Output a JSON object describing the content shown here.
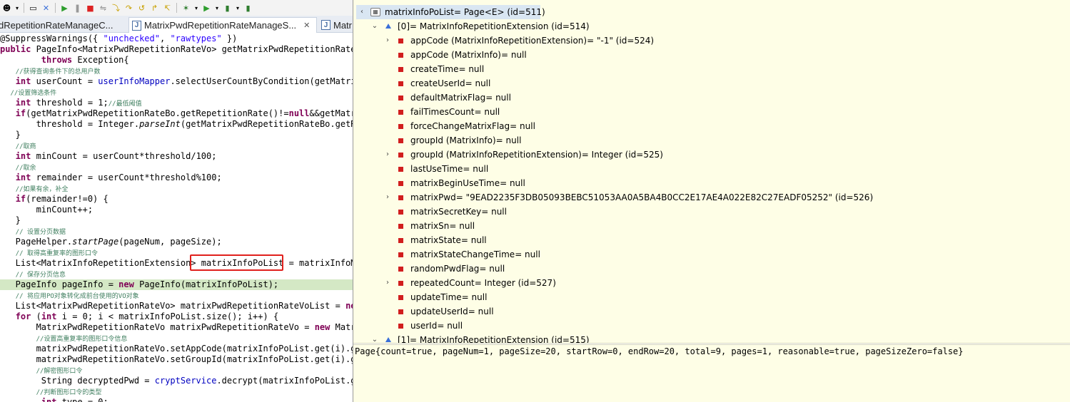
{
  "toolbar": {
    "icons": [
      "person-icon",
      "dropdown-icon",
      "console-icon",
      "pin-icon",
      "resume-icon",
      "suspend-icon",
      "terminate-icon",
      "disconnect-icon",
      "step-into-icon",
      "step-over-icon",
      "step-return-icon",
      "drop-to-frame-icon",
      "use-step-filters-icon",
      "debug-icon",
      "run-icon",
      "external-tools-icon",
      "coverage-icon"
    ]
  },
  "tabs": [
    {
      "label": "dRepetitionRateManageC...",
      "active": false
    },
    {
      "label": "MatrixPwdRepetitionRateManageS...",
      "active": true,
      "close": "✕"
    },
    {
      "label": "Matr",
      "active": false
    }
  ],
  "code_lines": [
    "@SuppressWarnings({ \"unchecked\", \"rawtypes\" })",
    "public PageInfo<MatrixPwdRepetitionRateVo> getMatrixPwdRepetitionRateLi",
    "        throws Exception{",
    "   //获得查询条件下的总用户数",
    "   int userCount = userInfoMapper.selectUserCountByCondition(getMatrix",
    "  //设置筛选条件",
    "   int threshold = 1;//最低阈值",
    "   if(getMatrixPwdRepetitionRateBo.getRepetitionRate()!=null&&getMatri",
    "       threshold = Integer.parseInt(getMatrixPwdRepetitionRateBo.getRe",
    "   }",
    "   //取商",
    "   int minCount = userCount*threshold/100;",
    "   //取余",
    "   int remainder = userCount*threshold%100;",
    "   //如果有余，补全",
    "   if(remainder!=0) {",
    "       minCount++;",
    "   }",
    "   // 设置分页数据",
    "   PageHelper.startPage(pageNum, pageSize);",
    "   // 取得高重复率的图形口令",
    "   List<MatrixInfoRepetitionExtension> matrixInfoPoList = matrixInfoMa",
    "   // 保存分页信息",
    "   PageInfo pageInfo = new PageInfo(matrixInfoPoList);",
    "   // 将应用PO对象转化成前台使用的VO对象",
    "   List<MatrixPwdRepetitionRateVo> matrixPwdRepetitionRateVoList = new",
    "   for (int i = 0; i < matrixInfoPoList.size(); i++) {",
    "       MatrixPwdRepetitionRateVo matrixPwdRepetitionRateVo = new Matri",
    "       //设置高重复率的图形口令信息",
    "       matrixPwdRepetitionRateVo.setAppCode(matrixInfoPoList.get(i).ge",
    "       matrixPwdRepetitionRateVo.setGroupId(matrixInfoPoList.get(i).ge",
    "       //解密图形口令",
    "        String decryptedPwd = cryptService.decrypt(matrixInfoPoList.ge",
    "       //判断图形口令的类型",
    "        int type = 0;"
  ],
  "debug": {
    "root": "matrixInfoPoList= Page<E>  (id=511)",
    "items": [
      {
        "label": "[0]= MatrixInfoRepetitionExtension  (id=514)",
        "twisty": "⌄",
        "icon": "final-field-icon",
        "level": 1
      },
      {
        "label": "appCode (MatrixInfoRepetitionExtension)= \"-1\" (id=524)",
        "twisty": "›",
        "icon": "field-icon",
        "level": 2
      },
      {
        "label": "appCode (MatrixInfo)= null",
        "twisty": "",
        "icon": "field-icon",
        "level": 2
      },
      {
        "label": "createTime= null",
        "twisty": "",
        "icon": "field-icon",
        "level": 2
      },
      {
        "label": "createUserId= null",
        "twisty": "",
        "icon": "field-icon",
        "level": 2
      },
      {
        "label": "defaultMatrixFlag= null",
        "twisty": "",
        "icon": "field-icon",
        "level": 2
      },
      {
        "label": "failTimesCount= null",
        "twisty": "",
        "icon": "field-icon",
        "level": 2
      },
      {
        "label": "forceChangeMatrixFlag= null",
        "twisty": "",
        "icon": "field-icon",
        "level": 2
      },
      {
        "label": "groupId (MatrixInfo)= null",
        "twisty": "",
        "icon": "field-icon",
        "level": 2
      },
      {
        "label": "groupId (MatrixInfoRepetitionExtension)= Integer  (id=525)",
        "twisty": "›",
        "icon": "field-icon",
        "level": 2
      },
      {
        "label": "lastUseTime= null",
        "twisty": "",
        "icon": "field-icon",
        "level": 2
      },
      {
        "label": "matrixBeginUseTime= null",
        "twisty": "",
        "icon": "field-icon",
        "level": 2
      },
      {
        "label": "matrixPwd= \"9EAD2235F3DB05093BEBC51053AA0A5BA4B0CC2E17AE4A022E82C27EADF05252\" (id=526)",
        "twisty": "›",
        "icon": "field-icon",
        "level": 2
      },
      {
        "label": "matrixSecretKey= null",
        "twisty": "",
        "icon": "field-icon",
        "level": 2
      },
      {
        "label": "matrixSn= null",
        "twisty": "",
        "icon": "field-icon",
        "level": 2
      },
      {
        "label": "matrixState= null",
        "twisty": "",
        "icon": "field-icon",
        "level": 2
      },
      {
        "label": "matrixStateChangeTime= null",
        "twisty": "",
        "icon": "field-icon",
        "level": 2
      },
      {
        "label": "randomPwdFlag= null",
        "twisty": "",
        "icon": "field-icon",
        "level": 2
      },
      {
        "label": "repeatedCount= Integer  (id=527)",
        "twisty": "›",
        "icon": "field-icon",
        "level": 2
      },
      {
        "label": "updateTime= null",
        "twisty": "",
        "icon": "field-icon",
        "level": 2
      },
      {
        "label": "updateUserId= null",
        "twisty": "",
        "icon": "field-icon",
        "level": 2
      },
      {
        "label": "userId= null",
        "twisty": "",
        "icon": "field-icon",
        "level": 2
      },
      {
        "label": "[1]= MatrixInfoRepetitionExtension  (id=515)",
        "twisty": "⌄",
        "icon": "final-field-icon",
        "level": 1
      }
    ],
    "detail": "Page{count=true, pageNum=1, pageSize=20, startRow=0, endRow=20, total=9, pages=1, reasonable=true, pageSizeZero=false}"
  },
  "colors": {
    "highlight_line": "#d4e8c5",
    "debug_background": "#fefee6",
    "selection": "#d9e6f2",
    "red_box": "#e0201c",
    "keyword": "#7f0055",
    "comment": "#3f7f5f"
  }
}
